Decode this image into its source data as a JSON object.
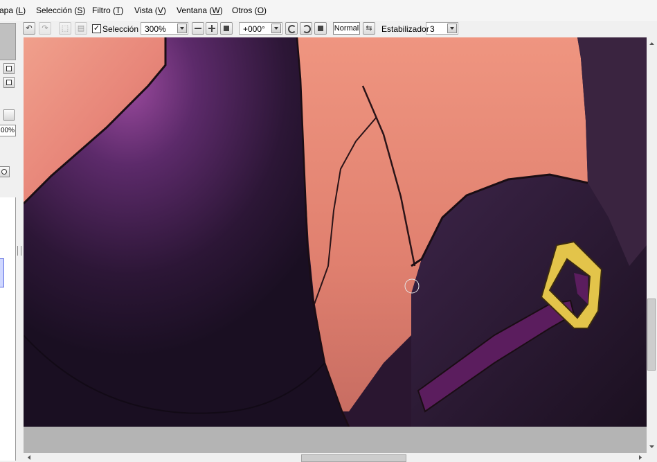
{
  "menu": [
    {
      "label": "apa",
      "key": "L"
    },
    {
      "label": "Selección",
      "key": "S"
    },
    {
      "label": "Filtro",
      "key": "T"
    },
    {
      "label": "Vista",
      "key": "V"
    },
    {
      "label": "Ventana",
      "key": "W"
    },
    {
      "label": "Otros",
      "key": "O"
    }
  ],
  "toolbar": {
    "selection_checked": true,
    "check_mark": "✓",
    "selection_label": "Selección",
    "zoom_value": "300%",
    "rotation_value": "+000°",
    "blend_mode": "Normal",
    "stabilizer_label": "Estabilizador",
    "stabilizer_value": "3"
  },
  "left_panel": {
    "percent_value": "00%"
  },
  "scrollbars": {
    "vertical_position": 0.63,
    "horizontal_position": 0.45
  },
  "colors": {
    "skin": "#e7897a",
    "cloth": "#2a1630",
    "cloth_highlight": "#8a3f8e",
    "strap": "#5b1d5e",
    "buckle": "#e3c44a",
    "ui_background": "#f0f0f0",
    "canvas_surround": "#b4b4b4"
  }
}
